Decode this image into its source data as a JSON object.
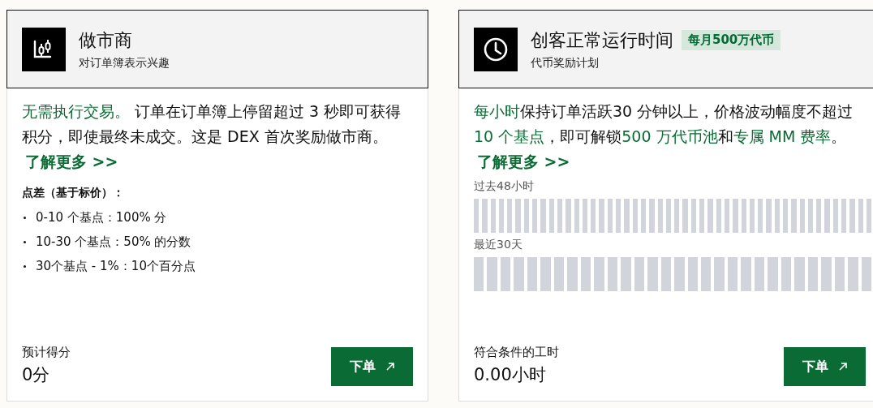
{
  "cards": [
    {
      "kind": "market_maker",
      "title": "做市商",
      "subtitle": "对订单簿表示兴趣",
      "description": "**无需执行交易。** 订单在订单簿上停留超过 3 秒即可获得积分，即使最终未成交。这是 DEX 首次奖励做市商。",
      "link": "了解更多 >>",
      "list_title": "点差（基于标价）：",
      "list": [
        "0-10 个基点：100% 分",
        "10-30 个基点：50% 的分数",
        "30个基点 - 1%：10个百分点"
      ],
      "footer_label": "预计得分",
      "footer_value": "0分",
      "button": "下单"
    },
    {
      "kind": "uptime",
      "title": "创客正常运行时间",
      "badge": "每月500万代币",
      "subtitle": "代币奖励计划",
      "description": "**每小时**保持订单活跃30 分钟以上，价格波动幅度不超过**10 个基点**，即可解锁**500 万代币池**和**专属 MM 费率**。",
      "link": "了解更多 >>",
      "timelines": [
        {
          "label": "过去48小时",
          "active": [
            false,
            false,
            false,
            false,
            false,
            false,
            false,
            false,
            false,
            false,
            false,
            false,
            false,
            false,
            false,
            false,
            false,
            false,
            false,
            false,
            false,
            false,
            false,
            false,
            false,
            false,
            false,
            false,
            false,
            false,
            false,
            false,
            false,
            false,
            false,
            false,
            false,
            false,
            false,
            false,
            false,
            false,
            false,
            false,
            false,
            false,
            false,
            false
          ]
        },
        {
          "label": "最近30天",
          "active": [
            false,
            false,
            false,
            false,
            false,
            false,
            false,
            false,
            false,
            false,
            false,
            false,
            false,
            false,
            false,
            false,
            false,
            false,
            false,
            false,
            false,
            false,
            false,
            false,
            false,
            false,
            false,
            false,
            false,
            false
          ]
        }
      ],
      "footer_label": "符合条件的工时",
      "footer_value": "0.00小时",
      "button": "下单"
    }
  ]
}
